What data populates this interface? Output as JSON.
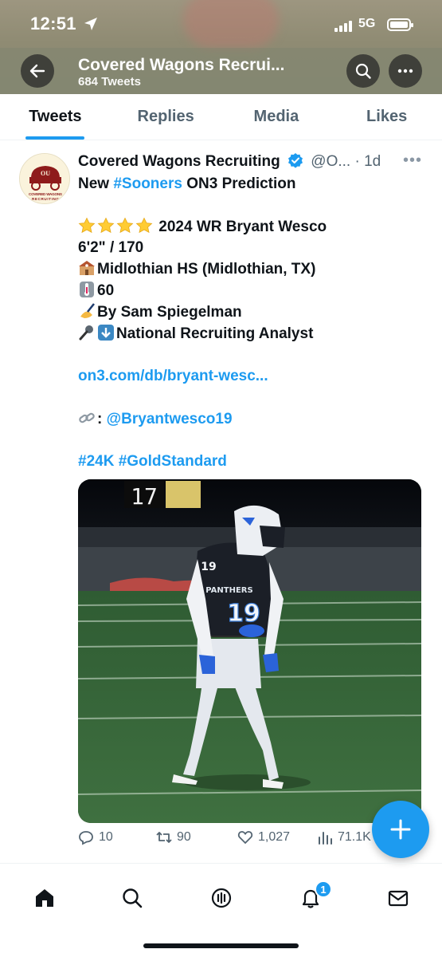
{
  "status_bar": {
    "time": "12:51",
    "network": "5G"
  },
  "header": {
    "title": "Covered Wagons Recrui...",
    "subtitle": "684 Tweets"
  },
  "tabs": [
    {
      "label": "Tweets",
      "active": true
    },
    {
      "label": "Replies",
      "active": false
    },
    {
      "label": "Media",
      "active": false
    },
    {
      "label": "Likes",
      "active": false
    }
  ],
  "tweet": {
    "author_name": "Covered Wagons Recruiting",
    "handle": "@O...",
    "time": "· 1d",
    "avatar_text": "COVERED WAGONS RECRUITING",
    "avatar_monogram": "OU",
    "line1_prefix": "New ",
    "line1_hashtag": "#Sooners",
    "line1_suffix": " ON3 Prediction",
    "stars_count": 4,
    "line_player": "2024 WR Bryant Wesco",
    "line_size": "6'2\" / 170",
    "line_school": "Midlothian HS (Midlothian, TX)",
    "line_rating": "60",
    "line_author": "By Sam Spiegelman",
    "line_analyst": "National Recruiting Analyst",
    "link": "on3.com/db/bryant-wesc...",
    "link_prefix": ":",
    "mention": "@Bryantwesco19",
    "hashtags": "#24K #GoldStandard",
    "photo_scoreboard": "17",
    "photo_jersey_text": "PANTHERS",
    "photo_jersey_number": "19",
    "stats": {
      "replies": "10",
      "retweets": "90",
      "likes": "1,027",
      "views": "71.1K"
    }
  },
  "bottom_nav": {
    "notifications_badge": "1"
  },
  "colors": {
    "accent": "#1d9bf0",
    "text": "#0f1419",
    "muted": "#536471"
  }
}
